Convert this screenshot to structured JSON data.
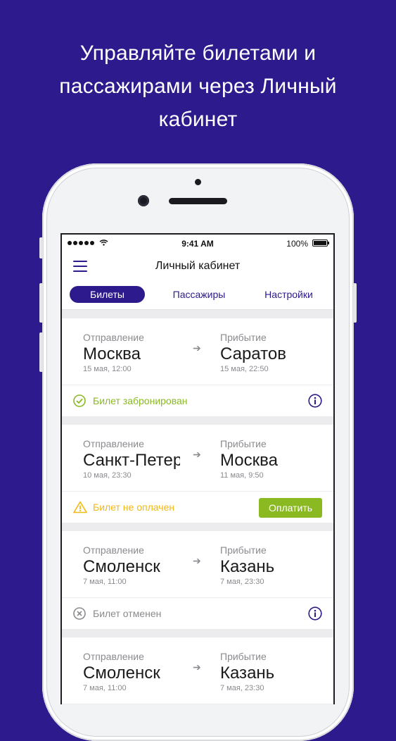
{
  "headline": {
    "line1": "Управляйте билетами и",
    "line2": "пассажирами через Личный",
    "line3": "кабинет"
  },
  "statusbar": {
    "time": "9:41 AM",
    "battery": "100%"
  },
  "navbar": {
    "title": "Личный кабинет",
    "menu_icon": "hamburger-menu-icon"
  },
  "tabs": [
    {
      "label": "Билеты",
      "active": true
    },
    {
      "label": "Пассажиры",
      "active": false
    },
    {
      "label": "Настройки",
      "active": false
    }
  ],
  "labels": {
    "departure": "Отправление",
    "arrival": "Прибытие"
  },
  "tickets": [
    {
      "from": "Москва",
      "from_time": "15 мая, 12:00",
      "to": "Саратов",
      "to_time": "15 мая, 22:50",
      "status": "Билет забронирован",
      "status_icon": "check-circle-icon",
      "status_color": "#8ab921",
      "action": "info"
    },
    {
      "from": "Санкт-Петербург",
      "from_time": "10 мая, 23:30",
      "to": "Москва",
      "to_time": "11 мая, 9:50",
      "status": "Билет не оплачен",
      "status_icon": "warning-icon",
      "status_color": "#f2b90f",
      "action": "pay",
      "action_label": "Оплатить"
    },
    {
      "from": "Смоленск",
      "from_time": "7 мая, 11:00",
      "to": "Казань",
      "to_time": "7 мая, 23:30",
      "status": "Билет отменен",
      "status_icon": "cancel-circle-icon",
      "status_color": "#8a8a8f",
      "action": "info"
    },
    {
      "from": "Смоленск",
      "from_time": "7 мая, 11:00",
      "to": "Казань",
      "to_time": "7 мая, 23:30"
    }
  ],
  "colors": {
    "background": "#2d1a8c",
    "accent": "#2d1a8c",
    "pay_button": "#8ab921"
  }
}
